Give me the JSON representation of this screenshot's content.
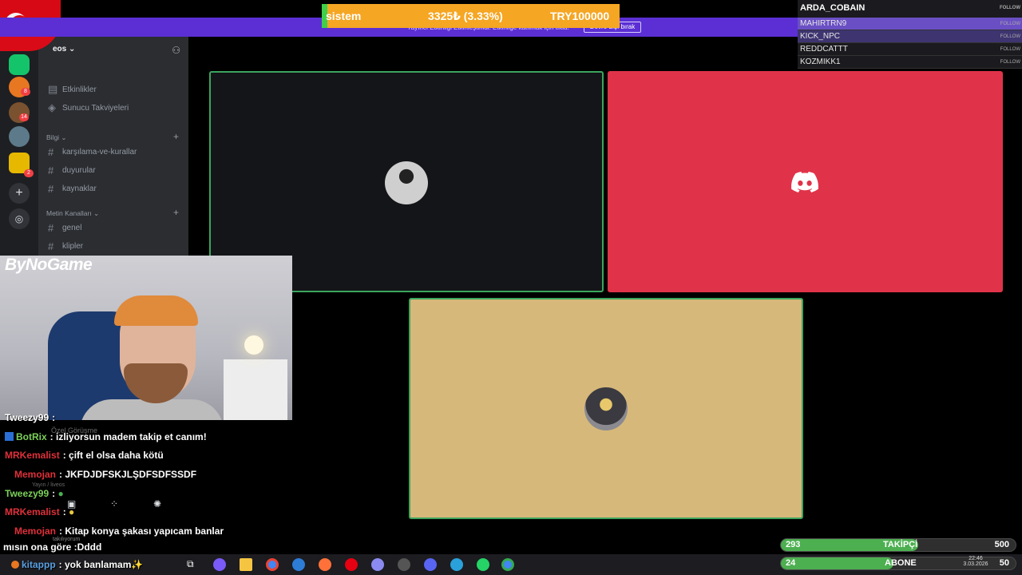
{
  "banner": {
    "text": "Yayıncı Etkinliği Etkinleştirildi. Etkinliğe katılmak için tıkla.",
    "button": "Devre dışı bırak"
  },
  "goal": {
    "label": "sistem",
    "amount": "3325₺ (3.33%)",
    "target": "TRY100000",
    "progress_percent": 3.33
  },
  "server": {
    "name": "eos",
    "badges": [
      "8",
      "14",
      "2"
    ]
  },
  "channels": {
    "top": [
      "Etkinlikler",
      "Sunucu Takviyeleri"
    ],
    "category1": "Bilgi",
    "cat1_items": [
      "karşılama-ve-kurallar",
      "duyurular",
      "kaynaklar"
    ],
    "category2": "Metin Kanalları",
    "cat2_items": [
      "genel",
      "klipler"
    ]
  },
  "stream_logo": "ByNoGame",
  "voice_panel": {
    "status": "Özel Görüşme",
    "sub": "Yayın / liveos",
    "user": "takılıyorum"
  },
  "chat": [
    {
      "user": "Tweezy99",
      "msg": ":",
      "color": "#ffffff"
    },
    {
      "user": "BotRix",
      "msg": ": izliyorsun madem takip et canım!",
      "color": "#7cd15a"
    },
    {
      "user": "MRKemalist",
      "msg": ": çift el olsa daha kötü",
      "color": "#e0303a"
    },
    {
      "user": "Memojan",
      "msg": ": JKFDJDFSKJLŞDFSDFSSDF",
      "color": "#e0303a"
    },
    {
      "user": "Tweezy99",
      "msg": ":",
      "color": "#7cd15a"
    },
    {
      "user": "MRKemalist",
      "msg": ":",
      "color": "#e0303a"
    },
    {
      "user": "Memojan",
      "msg": ": Kitap konya şakası yapıcam banlar",
      "color": "#e0303a"
    },
    {
      "user": "",
      "msg": "mısın ona göre :Dddd",
      "color": "#ffffff"
    },
    {
      "user": "kitappp",
      "msg": ": yok banlamam✨",
      "color": "#5aa0e0"
    }
  ],
  "followers": {
    "latest": "ARDA_COBAIN",
    "list": [
      "MAHIRTRN9",
      "KICK_NPC",
      "REDDCATTT",
      "KOZMIKK1"
    ],
    "button": "FOLLOW"
  },
  "follower_goal": {
    "current": "293",
    "label": "TAKİPÇİ",
    "target": "500",
    "progress_fraction": 0.586
  },
  "sub_goal": {
    "current": "24",
    "label": "ABONE",
    "target": "50",
    "progress_fraction": 0.48
  },
  "clock": {
    "time": "22:46",
    "date": "3.03.2026"
  },
  "colors": {
    "accent": "#5b2fd4",
    "discord_red": "#e0334a",
    "speaking": "#3ba55d",
    "goal": "#f5a623"
  }
}
